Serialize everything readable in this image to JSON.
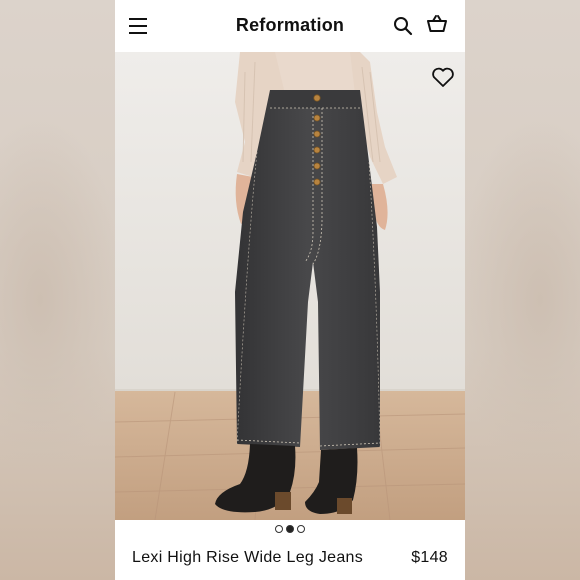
{
  "app": {
    "brand": "Reformation",
    "icons": {
      "menu": "hamburger-menu-icon",
      "search": "search-icon",
      "cart": "shopping-basket-icon",
      "wishlist": "heart-icon"
    }
  },
  "carousel": {
    "total": 3,
    "active_index": 1
  },
  "product": {
    "name": "Lexi High Rise Wide Leg Jeans",
    "price": "$148",
    "image_alt": "Model wearing black high rise wide leg jeans with exposed button fly, cream sweater and black ankle boots"
  },
  "colors": {
    "denim": "#3f3f40",
    "sweater": "#e7d6c7",
    "floor": "#c9a88a",
    "wall": "#ebe9e5"
  }
}
